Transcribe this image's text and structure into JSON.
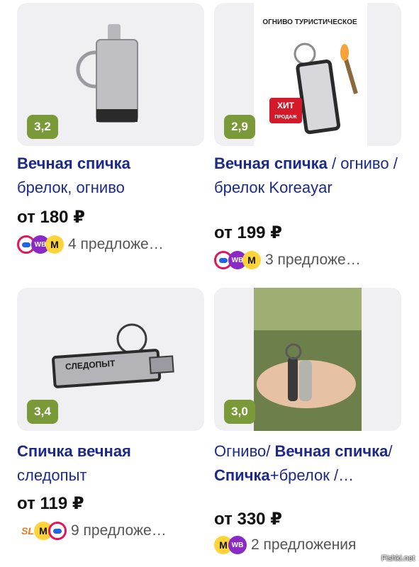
{
  "products": [
    {
      "rating": "3,2",
      "title_bold": "Вечная спичка",
      "title_rest": "брелок, огниво",
      "price": "от 180 ₽",
      "offers": "4 предложе…",
      "stores": [
        "ozon",
        "wb",
        "ym"
      ]
    },
    {
      "rating": "2,9",
      "title_bold": "Вечная спичка",
      "title_rest": " / огниво / брелок Koreayar",
      "price": "от 199 ₽",
      "offers": "3 предложе…",
      "stores": [
        "ozon",
        "wb",
        "ym"
      ],
      "badge": "ХИТ",
      "badge_sub": "ПРОДАЖ",
      "banner": "ОГНИВО ТУРИСТИЧЕСКОЕ"
    },
    {
      "rating": "3,4",
      "title_bold": "Спичка вечная",
      "title_rest": "следопыт",
      "price": "от 119 ₽",
      "offers": "9 предложе…",
      "stores": [
        "sl",
        "ym",
        "ozon"
      ],
      "engraving": "СЛЕДОПЫТ"
    },
    {
      "rating": "3,0",
      "title_pre": "Огниво/ ",
      "title_bold": "Вечная спичка",
      "title_mid": "/ ",
      "title_bold2": "Спичка",
      "title_rest": "+брелок /…",
      "price": "от 330 ₽",
      "offers": "2 предложения",
      "stores": [
        "ym",
        "wb"
      ]
    }
  ],
  "store_labels": {
    "wb": "WB",
    "ym": "M",
    "sl": "SL"
  },
  "watermark": "Fishki.net",
  "colors": {
    "rating_bg": "#7a9a3a",
    "title": "#1b2a8a"
  }
}
